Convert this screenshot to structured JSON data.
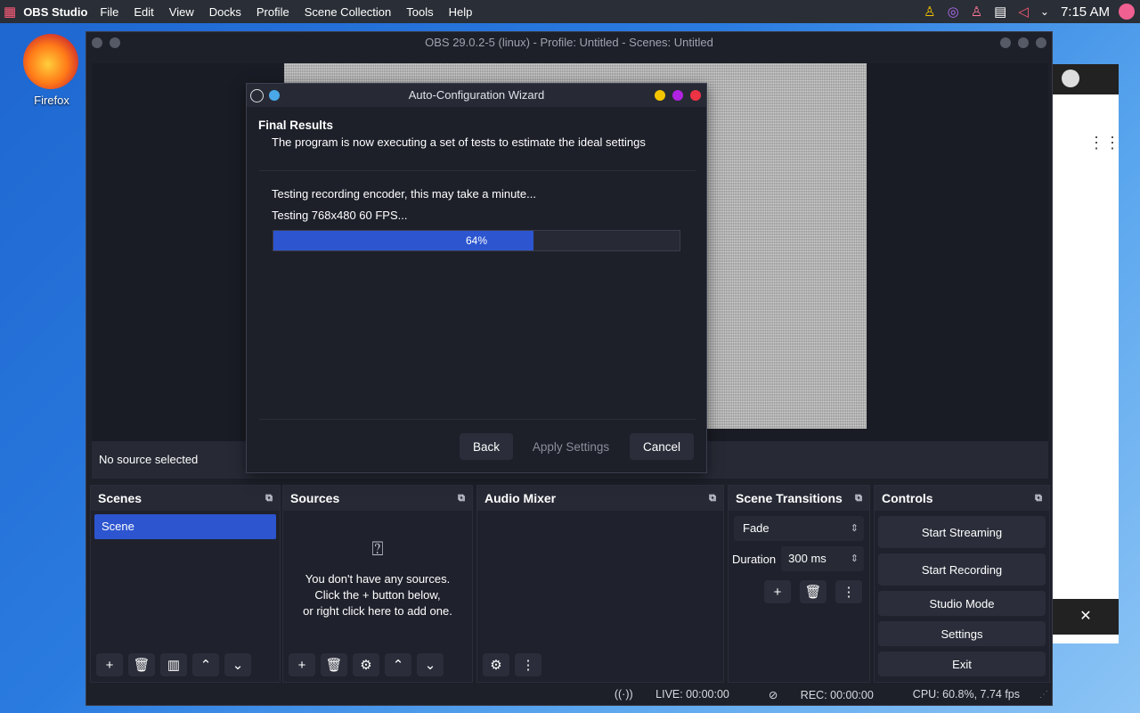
{
  "topbar": {
    "app_name": "OBS Studio",
    "menus": [
      "File",
      "Edit",
      "View",
      "Docks",
      "Profile",
      "Scene Collection",
      "Tools",
      "Help"
    ],
    "clock": "7:15 AM"
  },
  "desktop": {
    "firefox_label": "Firefox"
  },
  "obs": {
    "title": "OBS 29.0.2-5 (linux) - Profile: Untitled - Scenes: Untitled",
    "no_source": "No source selected",
    "docks": {
      "scenes_title": "Scenes",
      "scene_item": "Scene",
      "sources_title": "Sources",
      "sources_empty_1": "You don't have any sources.",
      "sources_empty_2": "Click the + button below,",
      "sources_empty_3": "or right click here to add one.",
      "audio_title": "Audio Mixer",
      "transitions_title": "Scene Transitions",
      "transition_value": "Fade",
      "duration_label": "Duration",
      "duration_value": "300 ms",
      "controls_title": "Controls",
      "controls": [
        "Start Streaming",
        "Start Recording",
        "Studio Mode",
        "Settings",
        "Exit"
      ]
    },
    "status": {
      "live": "LIVE: 00:00:00",
      "rec": "REC: 00:00:00",
      "cpu": "CPU: 60.8%, 7.74 fps"
    }
  },
  "wizard": {
    "title": "Auto-Configuration Wizard",
    "heading": "Final Results",
    "subtitle": "The program is now executing a set of tests to estimate the ideal settings",
    "line1": "Testing recording encoder, this may take a minute...",
    "line2": "Testing 768x480 60 FPS...",
    "progress": 64,
    "progress_label": "64%",
    "back": "Back",
    "apply": "Apply Settings",
    "cancel": "Cancel"
  },
  "colors": {
    "accent": "#2c55cf",
    "dot_yellow": "#f5c400",
    "dot_purple": "#b023e0",
    "dot_red": "#ee3344",
    "dot_blue": "#4aa8e8"
  }
}
